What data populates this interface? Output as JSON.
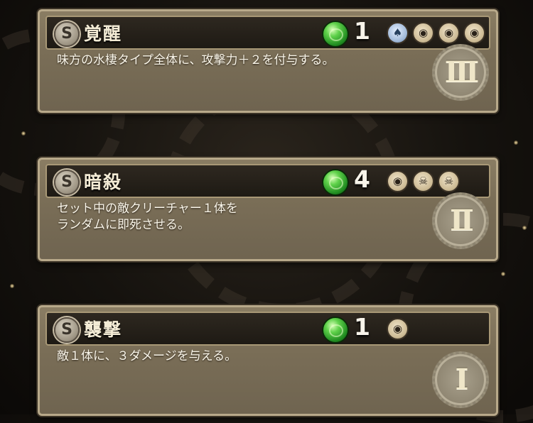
{
  "skills": [
    {
      "badge": "S",
      "title": "覚醒",
      "cost": "1",
      "icons": [
        "spade-icon",
        "creature-face-icon",
        "creature-face-icon",
        "creature-face-icon"
      ],
      "description": "味方の水棲タイプ全体に、攻撃力＋２を付与する。",
      "rank": "III"
    },
    {
      "badge": "S",
      "title": "暗殺",
      "cost": "4",
      "icons": [
        "creature-face-icon",
        "skull-icon",
        "skull-icon"
      ],
      "description": "セット中の敵クリーチャー１体を\nランダムに即死させる。",
      "rank": "II"
    },
    {
      "badge": "S",
      "title": "襲撃",
      "cost": "1",
      "icons": [
        "creature-face-icon"
      ],
      "description": "敵１体に、３ダメージを与える。",
      "rank": "I"
    }
  ],
  "colors": {
    "card": "#7a6e57",
    "header": "#1e1a14",
    "gem": "#3fb832",
    "text": "#faf6ea"
  }
}
